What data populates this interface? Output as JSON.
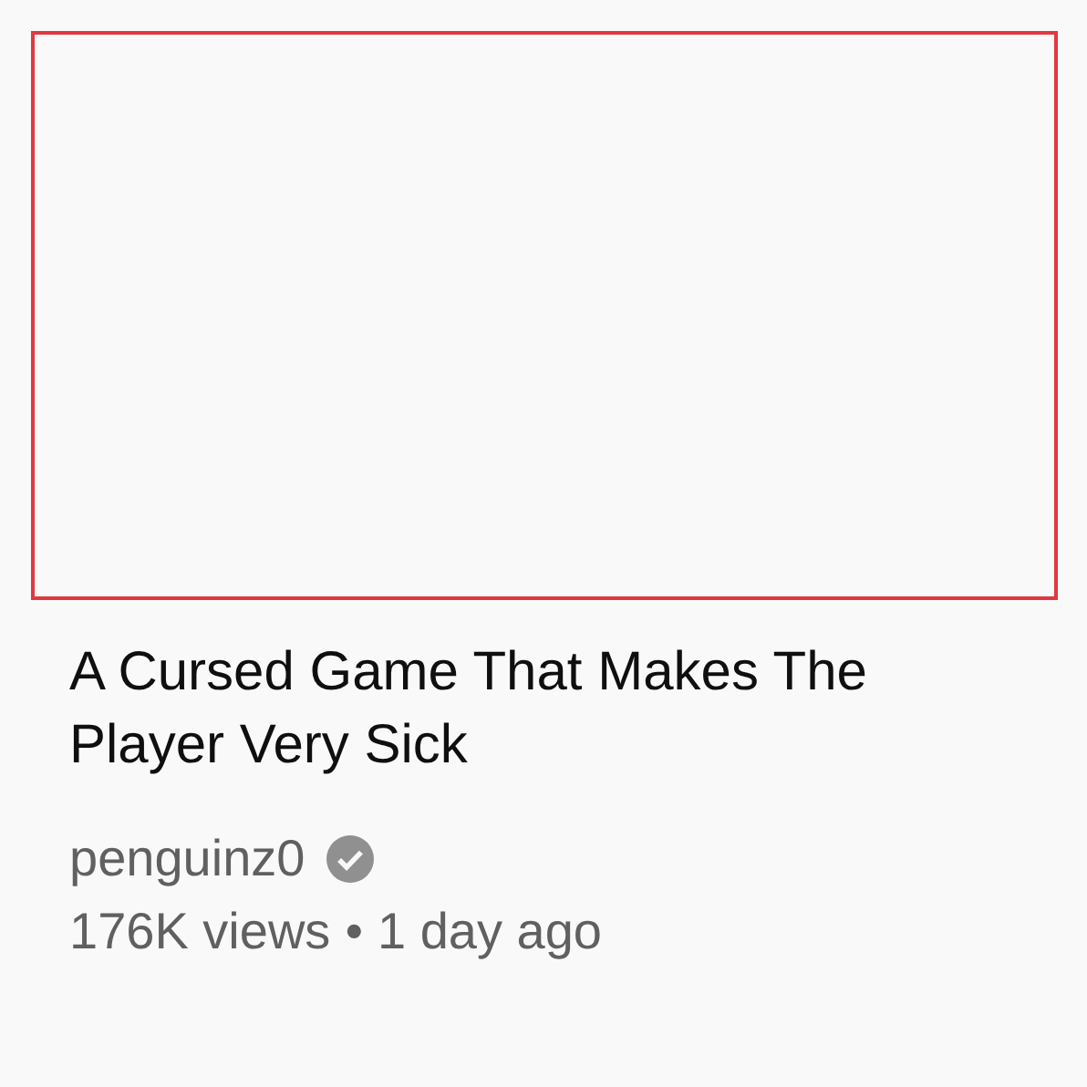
{
  "video": {
    "title": "A Cursed Game That Makes The Player Very Sick",
    "channel": "penguinz0",
    "verified": true,
    "views": "176K views",
    "separator": "•",
    "age": "1 day ago"
  }
}
